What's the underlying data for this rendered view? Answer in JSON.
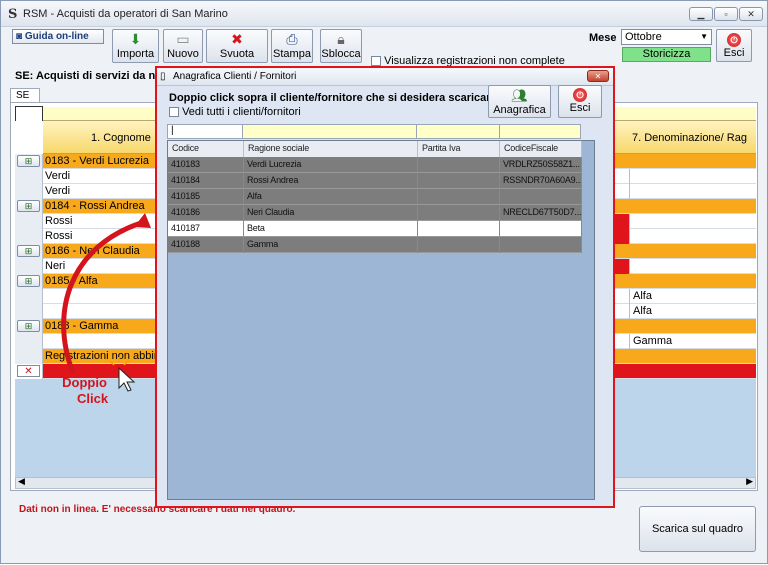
{
  "window": {
    "title": "RSM - Acquisti da operatori di San Marino",
    "app_icon": "S"
  },
  "toolbar": {
    "guida": "Guida on-line",
    "buttons": [
      {
        "label": "Importa",
        "icon": "import-icon"
      },
      {
        "label": "Nuovo",
        "icon": "new-icon"
      },
      {
        "label": "Svuota",
        "icon": "clear-icon"
      },
      {
        "label": "Stampa",
        "icon": "print-icon"
      },
      {
        "label": "Sblocca",
        "icon": "unlock-icon"
      }
    ],
    "visualizza": "Visualizza registrazioni non complete",
    "mese_label": "Mese",
    "mese_value": "Ottobre",
    "storicizza": "Storicizza",
    "esci": "Esci"
  },
  "section_title": "SE: Acquisti di servizi da nor",
  "tab": "SE",
  "grid": {
    "col_cognome": "1. Cognome",
    "col_denominazione": "7. Denominazione/ Rag",
    "rows": [
      {
        "kind": "group",
        "text": "0183 - Verdi Lucrezia"
      },
      {
        "kind": "line",
        "text": "Verdi",
        "right": ""
      },
      {
        "kind": "line",
        "text": "Verdi",
        "right": ""
      },
      {
        "kind": "group",
        "text": "0184 - Rossi Andrea"
      },
      {
        "kind": "line",
        "text": "Rossi",
        "right": "",
        "flag": true
      },
      {
        "kind": "line",
        "text": "Rossi",
        "right": "",
        "flag": true
      },
      {
        "kind": "group",
        "text": "0186 - Neri Claudia"
      },
      {
        "kind": "line",
        "text": "Neri",
        "right": "",
        "flag": true
      },
      {
        "kind": "group",
        "text": "0185 - Alfa"
      },
      {
        "kind": "line",
        "text": "",
        "right": "Alfa"
      },
      {
        "kind": "line",
        "text": "",
        "right": "Alfa"
      },
      {
        "kind": "group",
        "text": "0188 - Gamma"
      },
      {
        "kind": "line",
        "text": "",
        "right": "Gamma"
      },
      {
        "kind": "orange",
        "text": "Registrazioni non abbina"
      },
      {
        "kind": "red",
        "text": ""
      }
    ]
  },
  "annotation": {
    "line1": "Doppio",
    "line2": "Click"
  },
  "status_message": "Dati non in linea. E' necessario scaricare i dati nel quadro.",
  "scarica": "Scarica sul quadro",
  "dialog": {
    "title": "Anagrafica Clienti / Fornitori",
    "instruction": "Doppio click sopra il cliente/fornitore che si desidera scaricare",
    "checkbox": "Vedi tutti i clienti/fornitori",
    "anagrafica_btn": "Anagrafica",
    "esci_btn": "Esci",
    "columns": [
      "Codice",
      "Ragione sociale",
      "Partita Iva",
      "CodiceFiscale"
    ],
    "rows": [
      {
        "codice": "410183",
        "ragione": "Verdi Lucrezia",
        "piva": "",
        "cf": "VRDLRZ50S58Z1..."
      },
      {
        "codice": "410184",
        "ragione": "Rossi Andrea",
        "piva": "",
        "cf": "RSSNDR70A60A9..."
      },
      {
        "codice": "410185",
        "ragione": "Alfa",
        "piva": "",
        "cf": ""
      },
      {
        "codice": "410186",
        "ragione": "Neri Claudia",
        "piva": "",
        "cf": "NRECLD67T50D7..."
      },
      {
        "codice": "410187",
        "ragione": "Beta",
        "piva": "",
        "cf": ""
      },
      {
        "codice": "410188",
        "ragione": "Gamma",
        "piva": "",
        "cf": ""
      }
    ]
  },
  "colors": {
    "group_row": "#f7a81b",
    "highlight_red": "#e0151c",
    "selected_row": "#ffffff",
    "dialog_row": "#7d7d7d"
  }
}
